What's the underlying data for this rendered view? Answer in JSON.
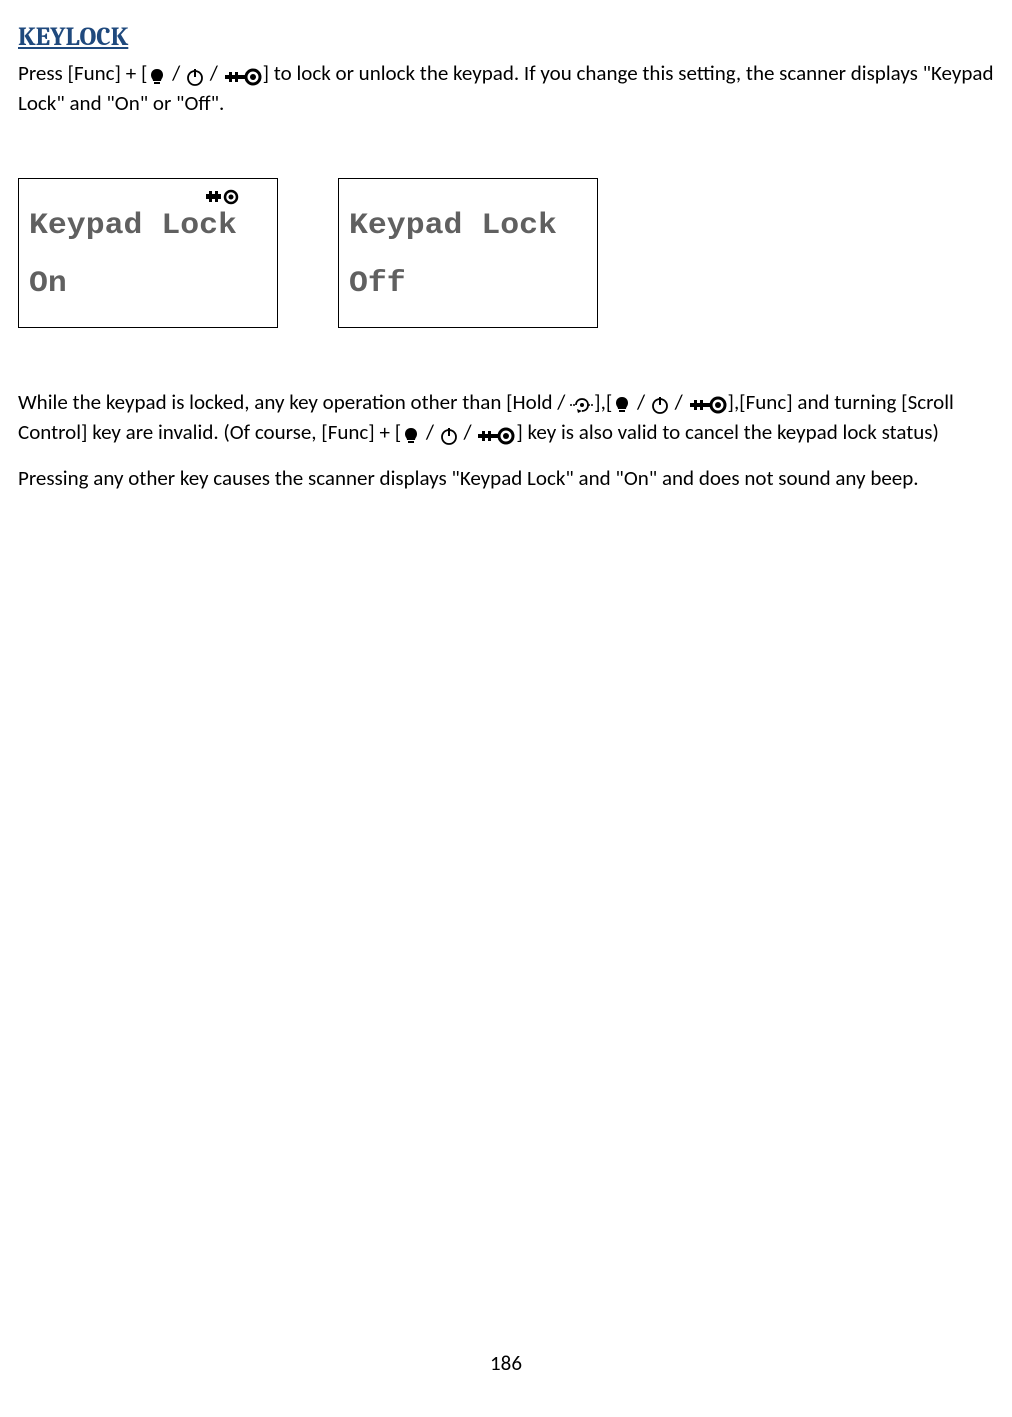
{
  "heading": "KEYLOCK",
  "para1_part1": "Press [Func] + [",
  "para1_part2": " / ",
  "para1_part3": " / ",
  "para1_part4": "] to lock or unlock the keypad. If you change this setting, the scanner displays \"Keypad Lock\" and \"On\" or \"Off\".",
  "display1": {
    "line1": "Keypad Lock",
    "line2": "On"
  },
  "display2": {
    "line1": "Keypad Lock",
    "line2": "Off"
  },
  "para2_part1": "While the keypad is locked, any key operation other than [Hold / ",
  "para2_part2": "],[",
  "para2_part3": " / ",
  "para2_part4": " / ",
  "para2_part5": "],[Func] and turning [Scroll Control] key  are invalid. (Of course, [Func] + [",
  "para2_part6": " / ",
  "para2_part7": " / ",
  "para2_part8": "] key is also valid to cancel the keypad lock status)",
  "para3": "Pressing any other key causes the scanner displays \"Keypad Lock\" and \"On\" and does not sound any beep.",
  "page_number": "186"
}
